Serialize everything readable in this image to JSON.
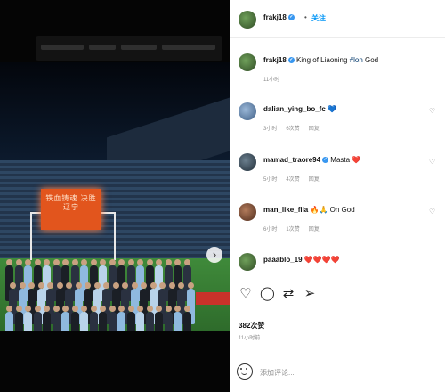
{
  "post": {
    "author": "frakj18",
    "follow_label": "关注",
    "caption_user": "frakj18",
    "caption_text": "King of Liaoning ",
    "caption_tag": "#lon",
    "caption_tail": " God",
    "caption_time": "11小时",
    "screen_text": "铁血铸魂 决胜辽宁"
  },
  "comments": [
    {
      "user": "dalian_ying_bo_fc",
      "text": "💙",
      "time": "3小时",
      "likes": "6次赞",
      "reply": "回复"
    },
    {
      "user": "mamad_traore94",
      "text": "Masta ❤️",
      "time": "5小时",
      "likes": "4次赞",
      "reply": "回复"
    },
    {
      "user": "man_like_fila",
      "text": "🔥🙏 On God",
      "time": "6小时",
      "likes": "1次赞",
      "reply": "回复"
    },
    {
      "user": "paaablo_19",
      "text": "❤️❤️❤️❤️",
      "time": "",
      "likes": "",
      "reply": ""
    }
  ],
  "likes_count": "382次赞",
  "post_time": "11小时前",
  "composer": {
    "placeholder": "添加评论..."
  },
  "icons": [
    "heart-icon",
    "comment-icon",
    "share-icon",
    "send-icon",
    "emoji-icon",
    "chevron-right-icon"
  ],
  "colors": {
    "accent": "#0095f6",
    "verified": "#3897f0"
  }
}
